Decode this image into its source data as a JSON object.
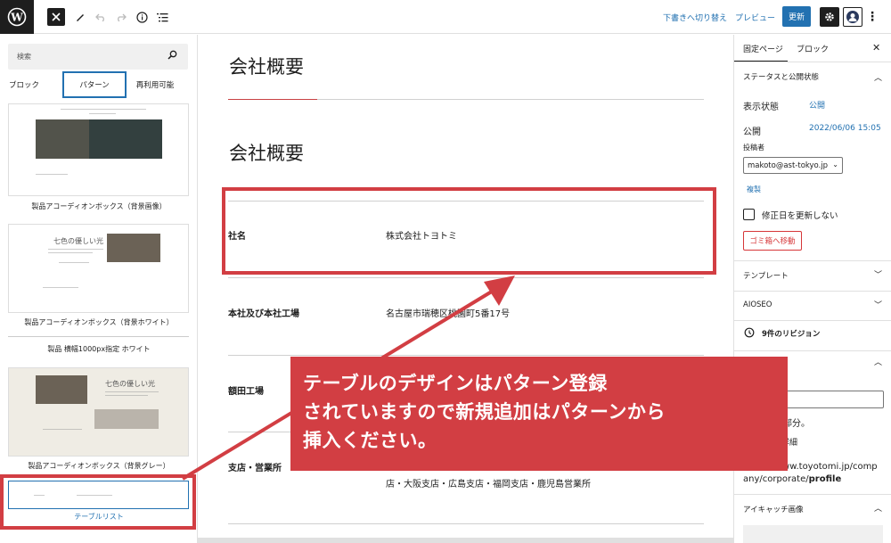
{
  "toolbar": {
    "draft_label": "下書きへ切り替え",
    "preview_label": "プレビュー",
    "update_label": "更新"
  },
  "inserter": {
    "search_placeholder": "検索",
    "tabs": [
      "ブロック",
      "パターン",
      "再利用可能"
    ],
    "patterns": [
      {
        "label": "製品アコーディオンボックス（背景画像）"
      },
      {
        "label": "製品アコーディオンボックス（背景ホワイト）",
        "sign": "七色の優しい光"
      },
      {
        "label": "製品 横幅1000px指定 ホワイト"
      },
      {
        "label": "製品アコーディオンボックス（背景グレー）",
        "sign": "七色の優しい光"
      },
      {
        "label": "テーブルリスト"
      }
    ]
  },
  "editor": {
    "heading1": "会社概要",
    "heading2": "会社概要",
    "rows": [
      {
        "label": "社名",
        "value": "株式会社トヨトミ"
      },
      {
        "label": "本社及び本社工場",
        "value": "名古屋市瑞穂区桃園町5番17号"
      },
      {
        "label": "額田工場",
        "value": ""
      },
      {
        "label": "支店・営業所",
        "value": "店・大阪支店・広島支店・福岡支店・鹿児島営業所"
      }
    ]
  },
  "sidebar": {
    "tabs": [
      "固定ページ",
      "ブロック"
    ],
    "status_heading": "ステータスと公開状態",
    "visibility_label": "表示状態",
    "visibility_value": "公開",
    "publish_label": "公開",
    "publish_value": "2022/06/06 15:05",
    "author_label": "投稿者",
    "author_value": "makoto@ast-tokyo.jp",
    "duplicate_label": "複製",
    "modify_label": "修正日を更新しない",
    "trash_label": "ゴミ箱へ移動",
    "template_label": "テンプレート",
    "aioseo_label": "AIOSEO",
    "revisions_label": "9件のリビジョン",
    "perma_after": "後の部分。",
    "perma_detail": "クの詳細",
    "perma_small": "ト",
    "perma_url_1": "https://www.toyotomi.jp/comp",
    "perma_url_2": "any/corporate/",
    "perma_url_bold": "profile",
    "featured_label": "アイキャッチ画像"
  },
  "callout": {
    "text": "テーブルのデザインはパターン登録\nされていますので新規追加はパターンから\n挿入ください。",
    "color": "#d23e43"
  }
}
